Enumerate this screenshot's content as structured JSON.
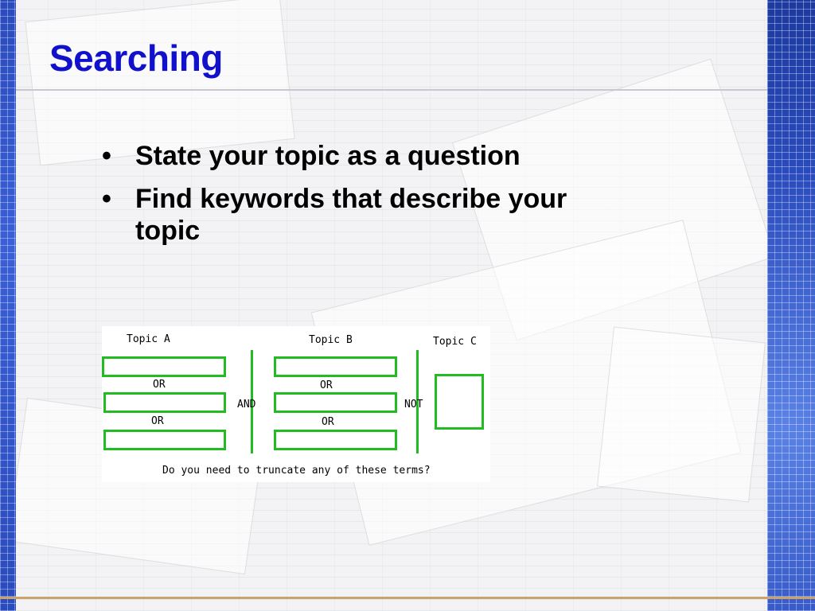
{
  "slide": {
    "title": "Searching",
    "bullets": [
      {
        "marker": "•",
        "text": "State your topic as a question"
      },
      {
        "marker": "•",
        "text": "Find keywords that describe your topic"
      }
    ]
  },
  "diagram": {
    "topic_a": "Topic A",
    "topic_b": "Topic B",
    "topic_c": "Topic C",
    "or": "OR",
    "and": "AND",
    "not": "NOT",
    "question": "Do you need to truncate any of these terms?"
  },
  "colors": {
    "title": "#1111cc",
    "box_border": "#22bb22",
    "frame": "#2a4bbd"
  }
}
